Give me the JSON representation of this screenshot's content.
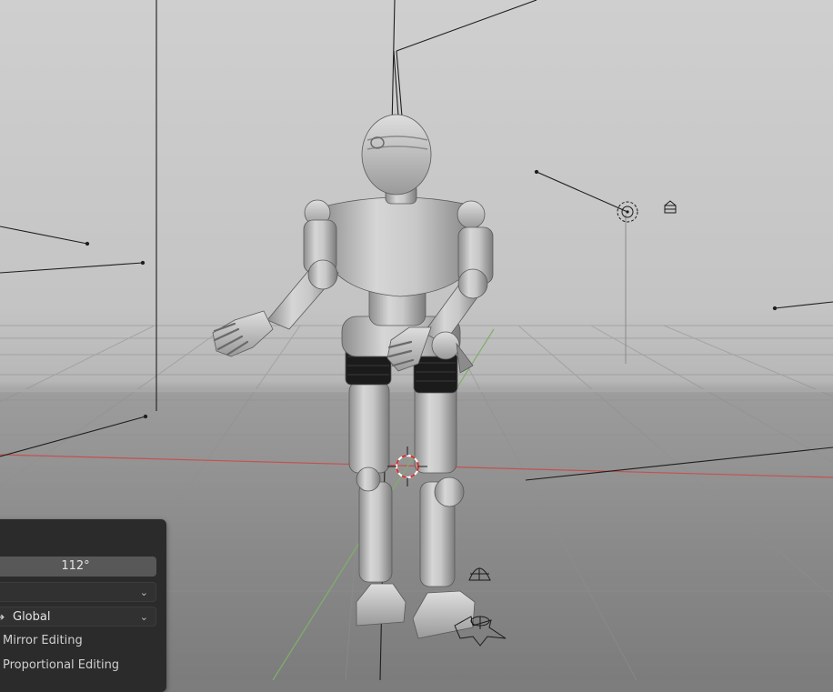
{
  "panel": {
    "angle_value": "112°",
    "orient_value": "",
    "pivot_value": "Global",
    "mirror_label": "Mirror Editing",
    "proportional_label": "Proportional Editing"
  },
  "colors": {
    "x_axis": "#c75050",
    "y_axis": "#7fb06a",
    "panel_bg": "#2b2b2b",
    "field_bg": "#585858"
  },
  "icons": [
    "light-icon",
    "area-light-icon",
    "camera-icon",
    "empty-icon",
    "3d-cursor-icon",
    "chevron-down-icon",
    "pivot-icon"
  ]
}
